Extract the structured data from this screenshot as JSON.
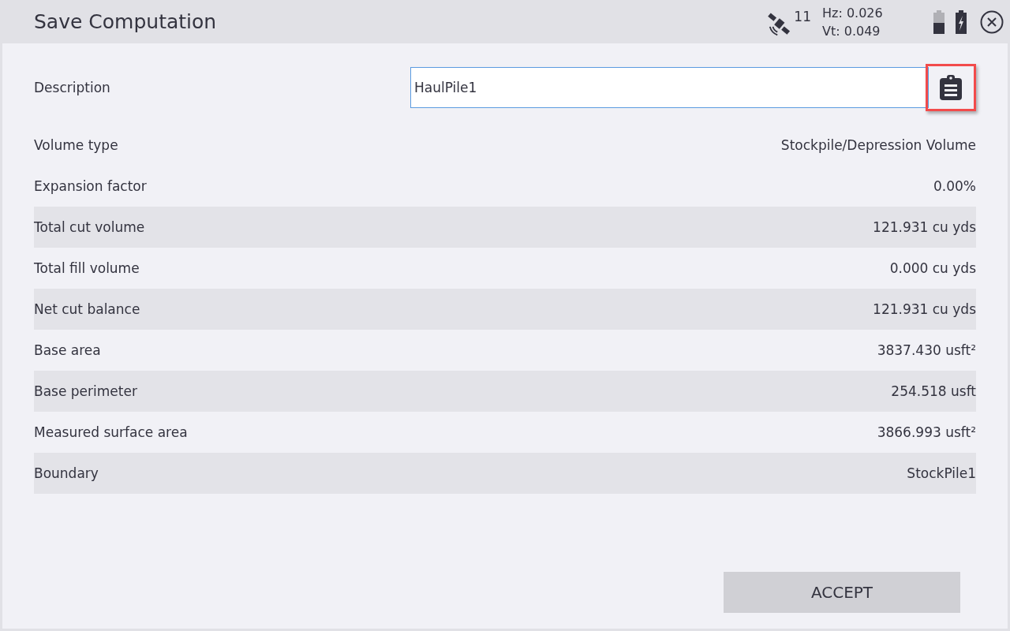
{
  "window": {
    "title": "Save Computation"
  },
  "status": {
    "satellites": "11",
    "hz": "Hz: 0.026",
    "vt": "Vt: 0.049"
  },
  "description": {
    "label": "Description",
    "value": "HaulPile1",
    "paste_highlighted": true
  },
  "rows": [
    {
      "label": "Volume type",
      "value": "Stockpile/Depression Volume",
      "shaded": false
    },
    {
      "label": "Expansion factor",
      "value": "0.00%",
      "shaded": false
    },
    {
      "label": "Total cut volume",
      "value": "121.931 cu yds",
      "shaded": true
    },
    {
      "label": "Total fill volume",
      "value": "0.000 cu yds",
      "shaded": false
    },
    {
      "label": "Net cut balance",
      "value": "121.931 cu yds",
      "shaded": true
    },
    {
      "label": "Base area",
      "value": "3837.430 usft²",
      "shaded": false
    },
    {
      "label": "Base perimeter",
      "value": "254.518 usft",
      "shaded": true
    },
    {
      "label": "Measured surface area",
      "value": "3866.993 usft²",
      "shaded": false
    },
    {
      "label": "Boundary",
      "value": "StockPile1",
      "shaded": true
    }
  ],
  "buttons": {
    "accept": "ACCEPT"
  }
}
